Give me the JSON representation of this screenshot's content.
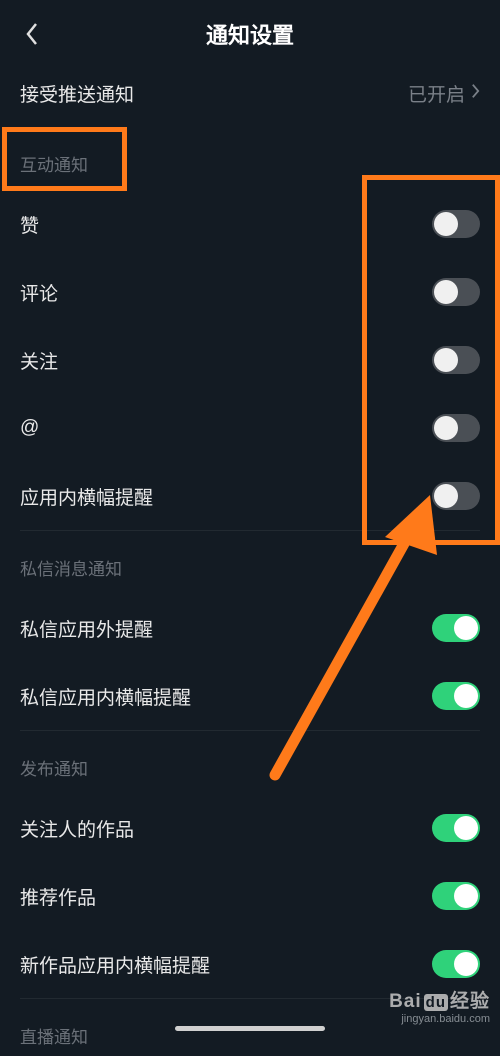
{
  "header": {
    "title": "通知设置"
  },
  "push": {
    "label": "接受推送通知",
    "status": "已开启"
  },
  "sections": {
    "interactive": {
      "title": "互动通知",
      "items": [
        {
          "label": "赞",
          "on": false
        },
        {
          "label": "评论",
          "on": false
        },
        {
          "label": "关注",
          "on": false
        },
        {
          "label": "@",
          "on": false
        },
        {
          "label": "应用内横幅提醒",
          "on": false
        }
      ]
    },
    "dm": {
      "title": "私信消息通知",
      "items": [
        {
          "label": "私信应用外提醒",
          "on": true
        },
        {
          "label": "私信应用内横幅提醒",
          "on": true
        }
      ]
    },
    "publish": {
      "title": "发布通知",
      "items": [
        {
          "label": "关注人的作品",
          "on": true
        },
        {
          "label": "推荐作品",
          "on": true
        },
        {
          "label": "新作品应用内横幅提醒",
          "on": true
        }
      ]
    },
    "live": {
      "title": "直播通知"
    }
  },
  "watermark": {
    "brand_prefix": "Bai",
    "brand_box": "du",
    "brand_suffix": "经验",
    "sub": "jingyan.baidu.com"
  },
  "annotation_color": "#ff7a1a"
}
